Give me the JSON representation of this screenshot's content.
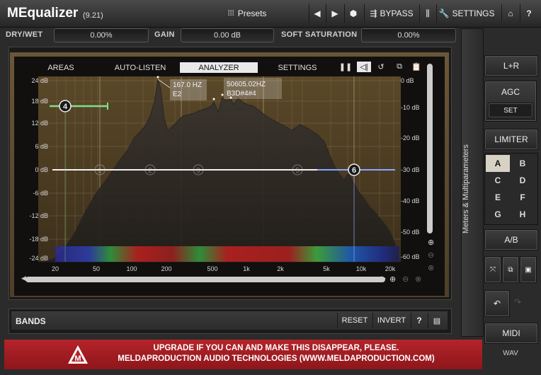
{
  "header": {
    "title": "MEqualizer",
    "version": "(9.21)",
    "presets_label": "Presets",
    "bypass_label": "BYPASS",
    "settings_label": "SETTINGS"
  },
  "params": {
    "drywet_label": "DRY/WET",
    "drywet_value": "0.00%",
    "gain_label": "GAIN",
    "gain_value": "0.00 dB",
    "softsat_label": "SOFT SATURATION",
    "softsat_value": "0.00%"
  },
  "tabs": [
    "AREAS",
    "AUTO-LISTEN",
    "ANALYZER",
    "SETTINGS"
  ],
  "active_tab": "ANALYZER",
  "graph": {
    "gain_scale": [
      "24 dB",
      "18 dB",
      "12 dB",
      "6 dB",
      "0 dB",
      "-6 dB",
      "-12 dB",
      "-18 dB",
      "-24 dB"
    ],
    "level_scale": [
      "0 dB",
      "-10 dB",
      "-20 dB",
      "-30 dB",
      "-40 dB",
      "-50 dB",
      "-60 dB"
    ],
    "freq_labels": [
      "20",
      "50",
      "100",
      "200",
      "500",
      "1k",
      "2k",
      "5k",
      "10k",
      "20k"
    ],
    "peak_labels": [
      {
        "line1": "167.0 HZ",
        "line2": "E2"
      },
      {
        "line1": "50605.02HZ",
        "line2": "B3D#4#4"
      }
    ],
    "bands_visible": [
      "1",
      "2",
      "3",
      "4",
      "5",
      "6"
    ]
  },
  "bands_bar": {
    "label": "BANDS",
    "reset_label": "RESET",
    "invert_label": "INVERT",
    "help_label": "?"
  },
  "upgrade": {
    "line1": "UPGRADE IF YOU CAN AND MAKE THIS DISAPPEAR, PLEASE.",
    "line2": "MELDAPRODUCTION AUDIO TECHNOLOGIES (WWW.MELDAPRODUCTION.COM)"
  },
  "side": {
    "meters_label": "Meters & Multiparameters",
    "lr_label": "L+R",
    "agc_label": "AGC",
    "agc_set_label": "SET",
    "limiter_label": "LIMITER",
    "ab_slots": [
      "A",
      "B",
      "C",
      "D",
      "E",
      "F",
      "G",
      "H"
    ],
    "ab_label": "A/B",
    "midi_label": "MIDI",
    "wav_label": "WAV"
  },
  "colors": {
    "accent_red": "#b4242a",
    "band4": "#7ee08a",
    "band6": "#8aa8ff",
    "panel_gold": "#6a5638"
  }
}
